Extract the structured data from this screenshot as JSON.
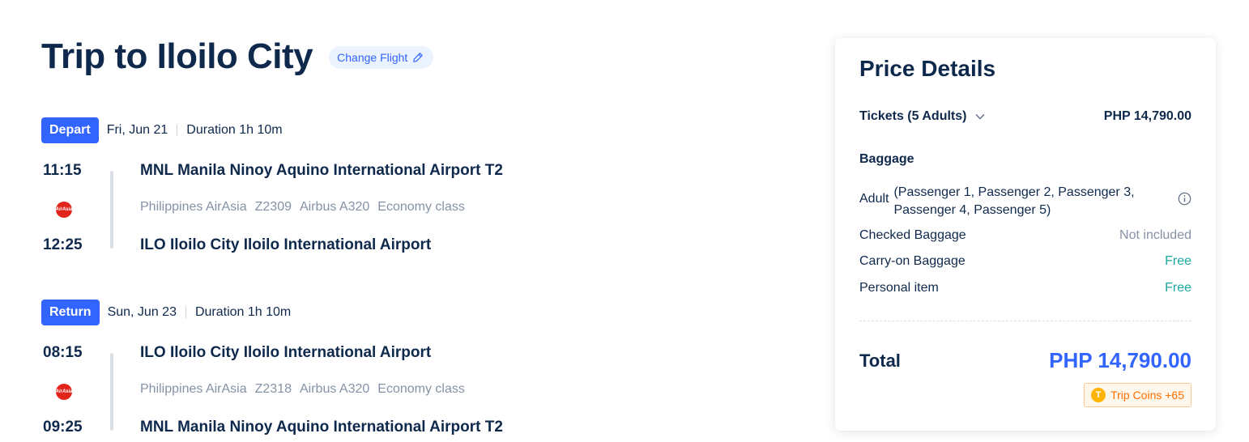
{
  "trip": {
    "title": "Trip to Iloilo City",
    "change_flight_label": "Change Flight"
  },
  "segments": [
    {
      "tag": "Depart",
      "date": "Fri, Jun 21",
      "duration": "Duration 1h 10m",
      "dep_time": "11:15",
      "arr_time": "12:25",
      "dep_airport": "MNL Manila Ninoy Aquino International Airport T2",
      "arr_airport": "ILO Iloilo City Iloilo International Airport",
      "airline": "Philippines AirAsia",
      "flight_no": "Z2309",
      "aircraft": "Airbus A320",
      "cabin": "Economy class",
      "airline_logo_text": "AirAsia"
    },
    {
      "tag": "Return",
      "date": "Sun, Jun 23",
      "duration": "Duration 1h 10m",
      "dep_time": "08:15",
      "arr_time": "09:25",
      "dep_airport": "ILO Iloilo City Iloilo International Airport",
      "arr_airport": "MNL Manila Ninoy Aquino International Airport T2",
      "airline": "Philippines AirAsia",
      "flight_no": "Z2318",
      "aircraft": "Airbus A320",
      "cabin": "Economy class",
      "airline_logo_text": "AirAsia"
    }
  ],
  "price": {
    "title": "Price Details",
    "tickets_label": "Tickets (5 Adults)",
    "tickets_value": "PHP 14,790.00",
    "baggage_title": "Baggage",
    "adult_label": "Adult",
    "adult_passengers": "(Passenger 1, Passenger 2, Passenger 3, Passenger 4, Passenger 5)",
    "checked_label": "Checked Baggage",
    "checked_value": "Not included",
    "carryon_label": "Carry-on Baggage",
    "carryon_value": "Free",
    "personal_label": "Personal item",
    "personal_value": "Free",
    "total_label": "Total",
    "total_value": "PHP 14,790.00",
    "trip_coins": "Trip Coins +65",
    "coin_symbol": "T"
  },
  "colors": {
    "brand_blue": "#3264ff",
    "text_dark": "#0f294d",
    "text_grey": "#8592a6",
    "free_teal": "#1ba8a0",
    "coins_orange": "#ff6f00"
  }
}
